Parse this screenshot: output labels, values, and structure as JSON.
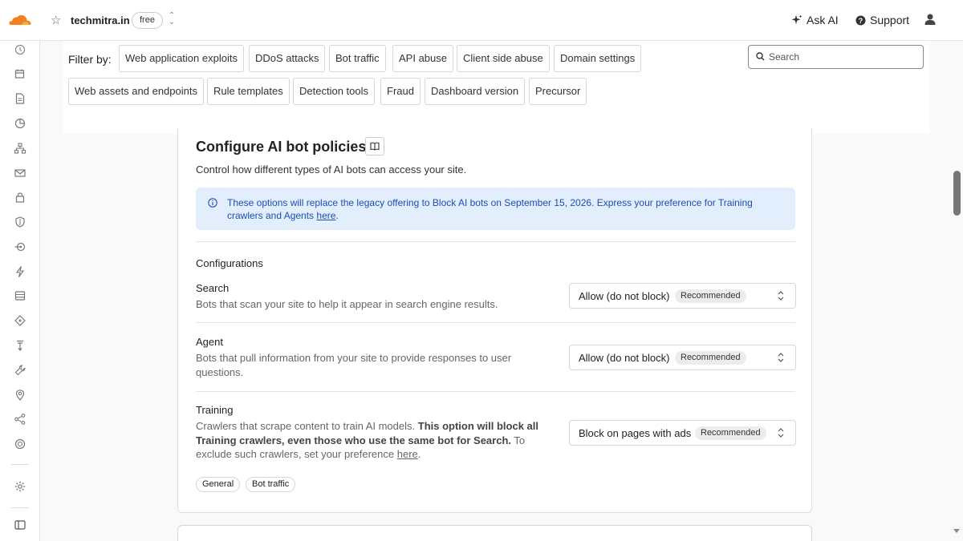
{
  "header": {
    "domain": "techmitra.in",
    "plan_badge": "free",
    "ask_ai_label": "Ask AI",
    "support_label": "Support",
    "logo_icon": "cloudflare-logo",
    "brand_color": "#f38020"
  },
  "sidebar": {
    "icons": [
      "history-icon",
      "calendar-icon",
      "document-icon",
      "pie-chart-icon",
      "network-icon",
      "email-icon",
      "lock-icon",
      "shield-icon",
      "route-icon",
      "bolt-icon",
      "database-icon",
      "diamond-icon",
      "pin-icon",
      "wrench-icon",
      "location-icon",
      "share-icon",
      "badge-icon",
      "settings-icon",
      "panel-icon"
    ]
  },
  "filters": {
    "label": "Filter by:",
    "chips_row1": [
      "Web application exploits",
      "DDoS attacks",
      "Bot traffic",
      "API abuse",
      "Client side abuse",
      "Domain settings"
    ],
    "chips_row2": [
      "Web assets and endpoints",
      "Rule templates",
      "Detection tools",
      "Fraud",
      "Dashboard version",
      "Precursor"
    ],
    "search_placeholder": "Search"
  },
  "card": {
    "title": "Configure AI bot policies",
    "description": "Control how different types of AI bots can access your site.",
    "info_text": "These options will replace the legacy offering to Block AI bots on September 15, 2026. Express your preference for Training crawlers and Agents",
    "info_link": "here",
    "info_end": ".",
    "info_color": "#1b4fb5",
    "configurations_heading": "Configurations",
    "rows": [
      {
        "title": "Search",
        "description": "Bots that scan your site to help it appear in search engine results.",
        "value": "Allow (do not block)",
        "badge": "Recommended"
      },
      {
        "title": "Agent",
        "description": "Bots that pull information from your site to provide responses to user questions.",
        "value": "Allow (do not block)",
        "badge": "Recommended"
      },
      {
        "title": "Training",
        "description_start": "Crawlers that scrape content to train AI models.",
        "description_bold": "This option will block all Training crawlers, even those who use the same bot for Search.",
        "description_end": "To exclude such crawlers, set your preference",
        "description_link": "here",
        "description_period": ".",
        "value": "Block on pages with ads",
        "badge": "Recommended"
      }
    ],
    "tags": [
      "General",
      "Bot traffic"
    ]
  }
}
